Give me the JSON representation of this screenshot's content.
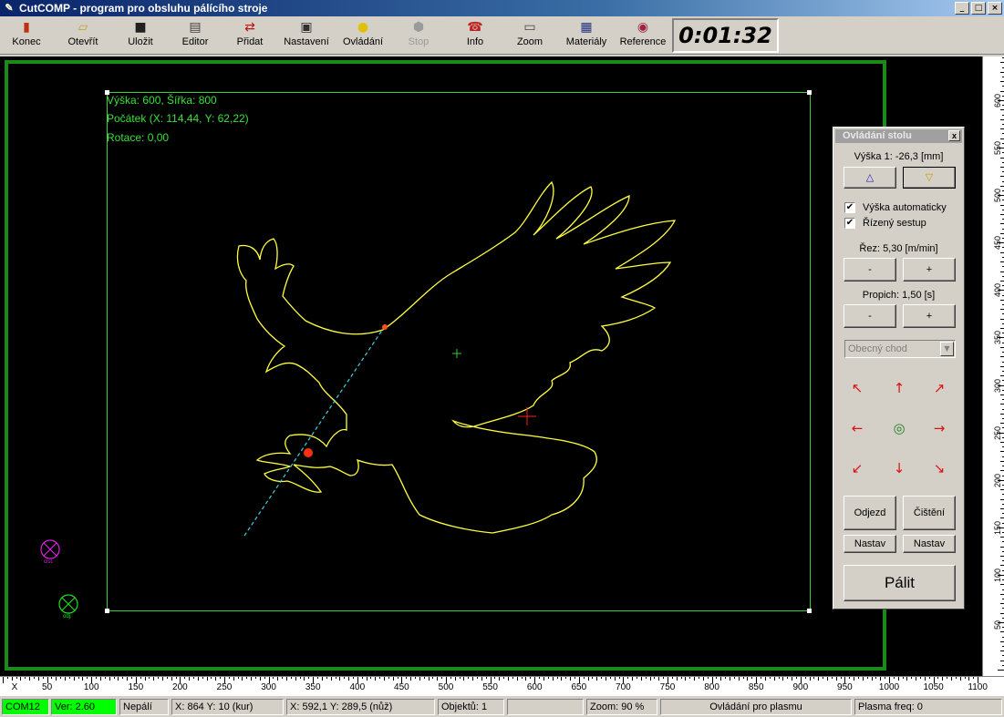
{
  "window": {
    "title": "CutCOMP - program pro obsluhu pálícího stroje",
    "minimize": "_",
    "maximize": "□",
    "close": "×"
  },
  "toolbar": {
    "buttons": [
      {
        "label": "Konec",
        "icon": "door-exit-icon"
      },
      {
        "label": "Otevřít",
        "icon": "folder-open-icon"
      },
      {
        "label": "Uložit",
        "icon": "floppy-disk-icon"
      },
      {
        "label": "Editor",
        "icon": "editor-icon"
      },
      {
        "label": "Přidat",
        "icon": "add-icon"
      },
      {
        "label": "Nastavení",
        "icon": "printer-settings-icon"
      },
      {
        "label": "Ovládání",
        "icon": "lightbulb-icon"
      },
      {
        "label": "Stop",
        "icon": "stop-sign-icon",
        "disabled": true
      },
      {
        "label": "Info",
        "icon": "telephone-icon"
      },
      {
        "label": "Zoom",
        "icon": "zoom-icon"
      },
      {
        "label": "Materiály",
        "icon": "table-icon"
      },
      {
        "label": "Reference",
        "icon": "target-icon"
      }
    ],
    "timer": "0:01:32"
  },
  "canvas": {
    "info": {
      "size": "Výška: 600, Šířka: 800",
      "origin": "Počátek (X: 114,44, Y: 62,22)",
      "rotation": "Rotace: 0,00"
    },
    "markers": [
      {
        "label": "cist.",
        "color": "#e020e0"
      },
      {
        "label": "odj.",
        "color": "#20e020"
      }
    ]
  },
  "ruler": {
    "x_axis_label": "X",
    "x_ticks": [
      "50",
      "100",
      "150",
      "200",
      "250",
      "300",
      "350",
      "400",
      "450",
      "500",
      "550",
      "600",
      "650",
      "700",
      "750",
      "800",
      "850",
      "900",
      "950",
      "1000",
      "1050",
      "1100"
    ],
    "y_ticks": [
      "50",
      "100",
      "150",
      "200",
      "250",
      "300",
      "350",
      "400",
      "450",
      "500",
      "550",
      "600"
    ]
  },
  "panel": {
    "title": "Ovládání stolu",
    "close": "x",
    "height_label": "Výška 1: -26,3 [mm]",
    "up_arrow": "△",
    "down_arrow": "▽",
    "auto_height": {
      "label": "Výška automaticky",
      "checked": "✔"
    },
    "controlled_descent": {
      "label": "Řízený sestup",
      "checked": "✔"
    },
    "cut_label": "Řez: 5,30 [m/min]",
    "pierce_label": "Propich: 1,50 [s]",
    "minus": "-",
    "plus": "+",
    "mode": "Obecný chod",
    "combo_arrow": "▼",
    "arrows": {
      "nw": "↖",
      "n": "↑",
      "ne": "↗",
      "w": "←",
      "center": "◎",
      "e": "→",
      "sw": "↙",
      "s": "↓",
      "se": "↘"
    },
    "departure": "Odjezd",
    "cleaning": "Čištění",
    "set": "Nastav",
    "burn": "Pálit"
  },
  "status": {
    "port": "COM12",
    "version": "Ver: 2.60",
    "state": "Nepálí",
    "machine_pos": "X: 864  Y: 10 (kur)",
    "cursor_pos": "X: 592,1  Y: 289,5 (nůž)",
    "objects": "Objektů: 1",
    "empty": "",
    "zoom": "Zoom: 90 %",
    "control_mode": "Ovládání pro plasmu",
    "plasma_freq": "Plasma freq: 0"
  },
  "colors": {
    "frame": "#1a8a1a",
    "sheet": "#3ad03a",
    "contour": "#ffff40",
    "path": "#40d0e0",
    "status_green": "#00ff00",
    "arrow_red": "#e01010"
  }
}
